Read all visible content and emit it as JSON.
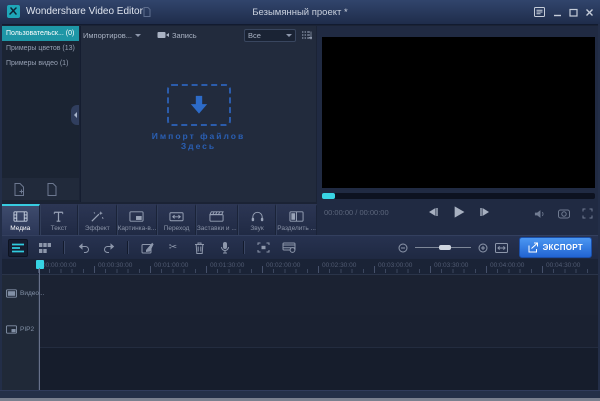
{
  "titlebar": {
    "app_title": "Wondershare Video Editor",
    "project_title": "Безымянный проект *"
  },
  "library": {
    "items": [
      {
        "label": "Пользовательск... (0)",
        "selected": true
      },
      {
        "label": "Примеры цветов (13)",
        "selected": false
      },
      {
        "label": "Примеры видео (1)",
        "selected": false
      }
    ]
  },
  "media_panel": {
    "import_menu": "Импортиров...",
    "record_button": "Запись",
    "filter_select": "Все",
    "import_zone_line1": "Импорт файлов",
    "import_zone_line2": "Здесь"
  },
  "preview": {
    "timecode": "00:00:00 / 00:00:00"
  },
  "main_tabs": [
    {
      "label": "Медиа",
      "selected": true
    },
    {
      "label": "Текст",
      "selected": false
    },
    {
      "label": "Эффект",
      "selected": false
    },
    {
      "label": "Картинка-в...",
      "selected": false
    },
    {
      "label": "Переход",
      "selected": false
    },
    {
      "label": "Заставки и ...",
      "selected": false
    },
    {
      "label": "Звук",
      "selected": false
    },
    {
      "label": "Разделить ...",
      "selected": false
    }
  ],
  "timeline": {
    "export_button": "ЭКСПОРТ",
    "ruler_ticks": [
      "00:00:00:00",
      "00:00:30:00",
      "00:01:00:00",
      "00:01:30:00",
      "00:02:00:00",
      "00:02:30:00",
      "00:03:00:00",
      "00:03:30:00",
      "00:04:00:00",
      "00:04:30:00"
    ],
    "tracks": [
      {
        "label": "Видео..."
      },
      {
        "label": "PIP2"
      }
    ]
  },
  "colors": {
    "accent_teal": "#1e96a6",
    "playhead_teal": "#36d3e3",
    "import_blue": "#2a5fb4",
    "export_blue": "#2f7de4",
    "selected_tab_line": "#37cbe0"
  }
}
